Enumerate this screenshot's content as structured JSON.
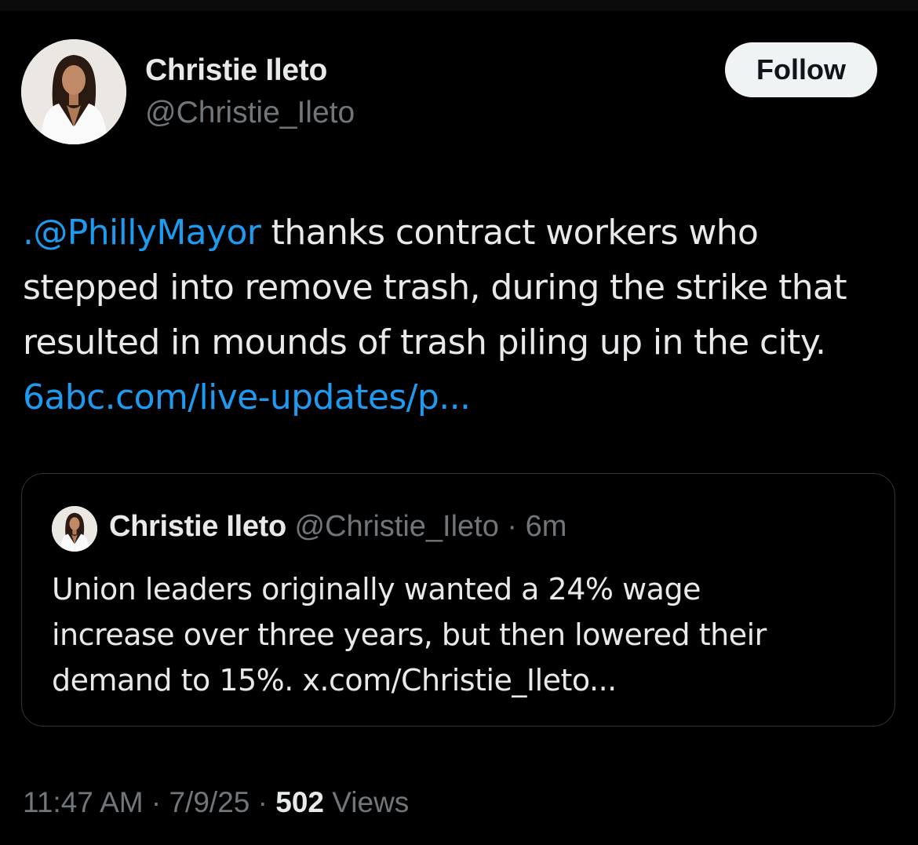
{
  "author": {
    "display_name": "Christie Ileto",
    "handle": "@Christie_Ileto"
  },
  "follow_button": {
    "label": "Follow"
  },
  "tweet": {
    "lines": [
      {
        "mention": ".@PhillyMayor",
        "text": " thanks contract workers who"
      },
      {
        "text": "stepped into remove trash, during the strike that"
      },
      {
        "text": "resulted in mounds of trash piling up in the city."
      },
      {
        "link": "6abc.com/live-updates/p..."
      }
    ]
  },
  "quoted_tweet": {
    "display_name": "Christie Ileto",
    "handle": "@Christie_Ileto",
    "separator": " · ",
    "time": "6m",
    "lines": [
      "Union leaders originally wanted a 24% wage",
      "increase over three years, but then lowered their",
      "demand to 15%. x.com/Christie_Ileto..."
    ]
  },
  "meta": {
    "time": "11:47 AM",
    "separator": " · ",
    "date": "7/9/25",
    "views_count": "502",
    "views_label": "Views"
  },
  "colors": {
    "background": "#000000",
    "text": "#e7e9ea",
    "secondary": "#71767b",
    "link": "#1d9bf0",
    "border": "#2f3336",
    "follow_bg": "#eff3f4"
  }
}
